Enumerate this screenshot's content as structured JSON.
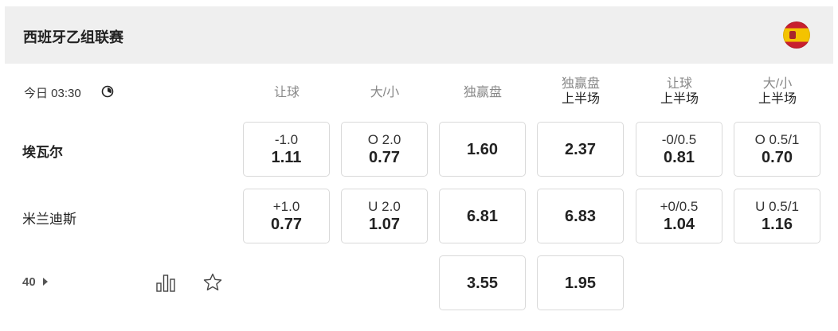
{
  "header": {
    "league": "西班牙乙组联赛",
    "flag_icon": "spain-flag-icon"
  },
  "match": {
    "time": "今日 03:30",
    "clock_icon": "clock-icon"
  },
  "columns": [
    {
      "line1": "让球",
      "line2": ""
    },
    {
      "line1": "大/小",
      "line2": ""
    },
    {
      "line1": "独赢盘",
      "line2": ""
    },
    {
      "line1": "独赢盘",
      "line2": "上半场"
    },
    {
      "line1": "让球",
      "line2": "上半场"
    },
    {
      "line1": "大/小",
      "line2": "上半场"
    }
  ],
  "teams": {
    "home": "埃瓦尔",
    "away": "米兰迪斯"
  },
  "odds": {
    "home": [
      {
        "line": "-1.0",
        "odds": "1.11"
      },
      {
        "line": "O 2.0",
        "odds": "0.77"
      },
      {
        "line": "",
        "odds": "1.60"
      },
      {
        "line": "",
        "odds": "2.37"
      },
      {
        "line": "-0/0.5",
        "odds": "0.81"
      },
      {
        "line": "O 0.5/1",
        "odds": "0.70"
      }
    ],
    "away": [
      {
        "line": "+1.0",
        "odds": "0.77"
      },
      {
        "line": "U 2.0",
        "odds": "1.07"
      },
      {
        "line": "",
        "odds": "6.81"
      },
      {
        "line": "",
        "odds": "6.83"
      },
      {
        "line": "+0/0.5",
        "odds": "1.04"
      },
      {
        "line": "U 0.5/1",
        "odds": "1.16"
      }
    ],
    "draw": [
      {
        "odds": "3.55"
      },
      {
        "odds": "1.95"
      }
    ]
  },
  "footer": {
    "more_count": "40",
    "stats_icon": "bar-chart-icon",
    "favorite_icon": "star-icon"
  }
}
